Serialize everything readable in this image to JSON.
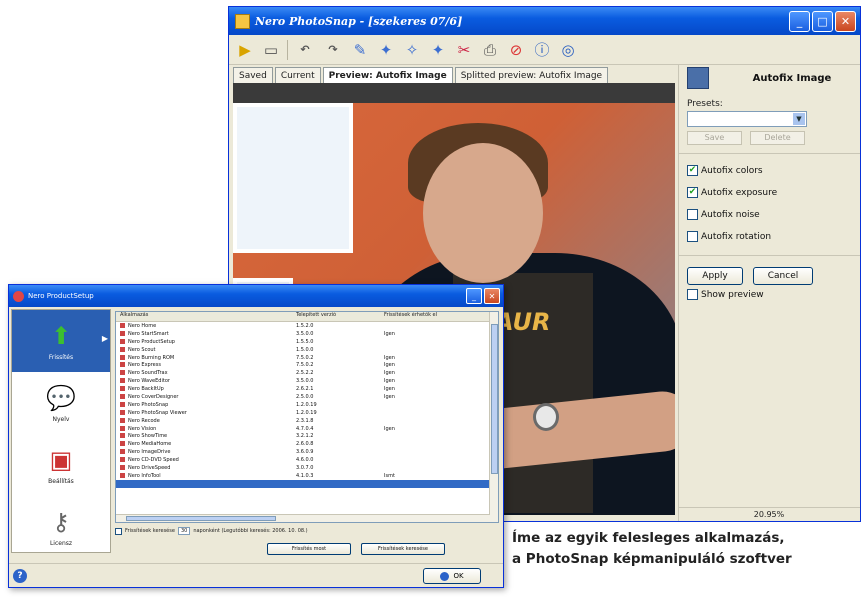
{
  "photosnap": {
    "title": "Nero PhotoSnap - [szekeres 07/6]",
    "tabs": [
      "Saved",
      "Current",
      "Preview: Autofix Image",
      "Splitted preview: Autofix Image"
    ],
    "active_tab": 2,
    "panel": {
      "title": "Autofix Image",
      "presets_label": "Presets:",
      "save_label": "Save",
      "delete_label": "Delete",
      "checkboxes": [
        {
          "label": "Autofix colors",
          "checked": true
        },
        {
          "label": "Autofix exposure",
          "checked": true
        },
        {
          "label": "Autofix noise",
          "checked": false
        },
        {
          "label": "Autofix rotation",
          "checked": false
        }
      ],
      "apply_label": "Apply",
      "cancel_label": "Cancel",
      "show_preview_label": "Show preview",
      "show_preview_checked": false
    },
    "status_zoom": "20.95%",
    "photo_text": "AUR"
  },
  "productsetup": {
    "title": "Nero ProductSetup",
    "nav": [
      {
        "label": "Frissítés",
        "icon": "green-up-arrow-icon",
        "active": true
      },
      {
        "label": "Nyelv",
        "icon": "speech-bubble-icon",
        "active": false
      },
      {
        "label": "Beállítás",
        "icon": "settings-box-icon",
        "active": false
      },
      {
        "label": "Licensz",
        "icon": "key-icon",
        "active": false
      }
    ],
    "columns": [
      "Alkalmazás",
      "Telepített verzió",
      "Frissítések érhetők el"
    ],
    "rows": [
      [
        "Nero Home",
        "1.5.2.0",
        ""
      ],
      [
        "Nero StartSmart",
        "3.5.0.0",
        "Igen"
      ],
      [
        "Nero ProductSetup",
        "1.5.5.0",
        ""
      ],
      [
        "Nero Scout",
        "1.5.0.0",
        ""
      ],
      [
        "Nero Burning ROM",
        "7.5.0.2",
        "Igen"
      ],
      [
        "Nero Express",
        "7.5.0.2",
        "Igen"
      ],
      [
        "Nero SoundTrax",
        "2.5.2.2",
        "Igen"
      ],
      [
        "Nero WaveEditor",
        "3.5.0.0",
        "Igen"
      ],
      [
        "Nero BackItUp",
        "2.6.2.1",
        "Igen"
      ],
      [
        "Nero CoverDesigner",
        "2.5.0.0",
        "Igen"
      ],
      [
        "Nero PhotoSnap",
        "1.2.0.19",
        ""
      ],
      [
        "Nero PhotoSnap Viewer",
        "1.2.0.19",
        ""
      ],
      [
        "Nero Recode",
        "2.3.1.8",
        ""
      ],
      [
        "Nero Vision",
        "4.7.0.4",
        "Igen"
      ],
      [
        "Nero ShowTime",
        "3.2.1.2",
        ""
      ],
      [
        "Nero MediaHome",
        "2.6.0.8",
        ""
      ],
      [
        "Nero ImageDrive",
        "3.6.0.9",
        ""
      ],
      [
        "Nero CD-DVD Speed",
        "4.6.0.0",
        ""
      ],
      [
        "Nero DriveSpeed",
        "3.0.7.0",
        ""
      ],
      [
        "Nero InfoTool",
        "4.1.0.3",
        "Ismt"
      ],
      [
        "",
        "",
        ""
      ]
    ],
    "selected_row": 20,
    "option_label": "Frissítések keresése",
    "option_value": "30",
    "option_suffix": "naponként (Legutóbbi keresés: 2006. 10. 08.)",
    "option_checked": true,
    "update_label": "Frissítés most",
    "check_label": "Frissítések keresése",
    "ok_label": "OK"
  },
  "caption": {
    "line1": "Íme az egyik felesleges alkalmazás,",
    "line2": "a PhotoSnap képmanipuláló szoftver"
  }
}
